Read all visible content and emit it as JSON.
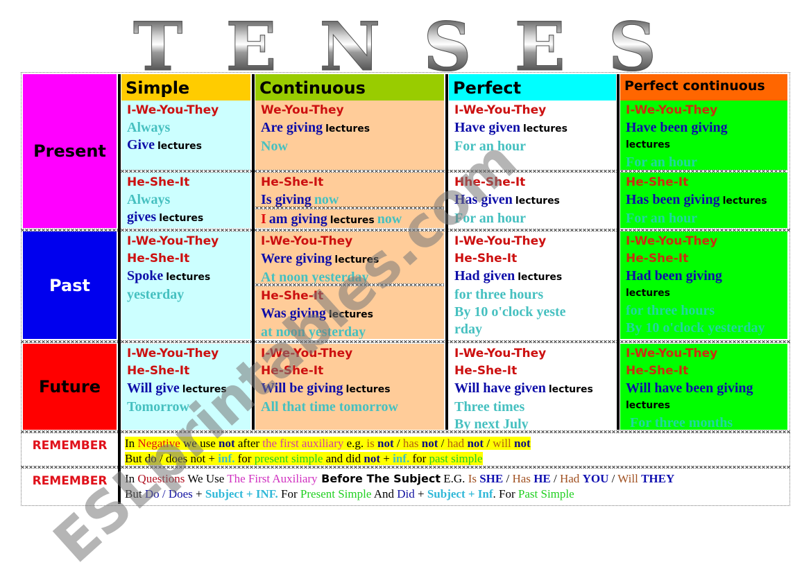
{
  "title": "TENSES",
  "headers": {
    "simple": "Simple",
    "continuous": "Continuous",
    "perfect": "Perfect",
    "perfect_continuous": "Perfect continuous"
  },
  "rows": {
    "present": "Present",
    "past": "Past",
    "future": "Future"
  },
  "colors": {
    "present": "#ff00ff",
    "past": "#0000ee",
    "future": "#ff0000",
    "simple_header": "#ffcc00",
    "continuous_header": "#99cc00",
    "perfect_header": "#00ffff",
    "perfect_continuous_header": "#ff6600",
    "simple_bg": "#ccffff",
    "continuous_bg": "#ffcc99",
    "perfect_bg": "#ffffff",
    "perfect_continuous_bg": "#00ff00"
  },
  "cells": {
    "present_simple_a": {
      "pronoun": "I-We-You-They",
      "time": "Always",
      "verb": "Give",
      "obj": "lectures"
    },
    "present_simple_b": {
      "pronoun": "He-She-It",
      "time": "Always",
      "verb": "gives",
      "obj": "lectures"
    },
    "present_cont_a": {
      "pronoun": "We-You-They",
      "verb": "Are giving",
      "obj": "lectures",
      "time": "Now"
    },
    "present_cont_b": {
      "pronoun": "He-She-It",
      "verb": "Is giving",
      "time": "now"
    },
    "present_cont_c": {
      "subject": "I",
      "verb": "am giving",
      "obj": "lectures",
      "time": "now"
    },
    "present_perf_a": {
      "pronoun": "I-We-You-They",
      "verb": "Have given",
      "obj": "lectures",
      "time": "For an hour"
    },
    "present_perf_b": {
      "pronoun": "Hhe-She-It",
      "verb": "Has given",
      "obj": "lectures",
      "time": "For an hour"
    },
    "present_pc_a": {
      "pronoun": "I-We-You-They",
      "verb": "Have been giving",
      "obj": "lectures",
      "time": "For an hour"
    },
    "present_pc_b": {
      "pronoun": "He-She-It",
      "verb": "Has been giving",
      "obj": "lectures",
      "time": "For an hour"
    },
    "past_simple": {
      "pronoun1": "I-We-You-They",
      "pronoun2": "He-She-It",
      "verb": "Spoke",
      "obj": "lectures",
      "time": "yesterday"
    },
    "past_cont_a": {
      "pronoun": "I-We-You-They",
      "verb": "Were giving",
      "obj": "lectures",
      "time": "At noon yesterday"
    },
    "past_cont_b": {
      "pronoun": "He-She-It",
      "verb": "Was giving",
      "obj": "lectures",
      "time": "at noon yesterday"
    },
    "past_perf": {
      "pronoun1": "I-We-You-They",
      "pronoun2": "He-She-It",
      "verb": "Had given",
      "obj": "lectures",
      "time1": "for three hours",
      "time2a": "By 10 o'clock yeste",
      "time2b": "rday"
    },
    "past_pc": {
      "pronoun1": "I-We-You-They",
      "pronoun2": "He-She-It",
      "verb": "Had been giving",
      "obj": "lectures",
      "time1": "for three hours",
      "time2": "By 10 o'clock yesterday"
    },
    "future_simple": {
      "pronoun1": "I-We-You-They",
      "pronoun2": "He-She-It",
      "verb": "Will give",
      "obj": "lectures",
      "time": "Tomorrow"
    },
    "future_cont": {
      "pronoun1": "I-We-You-They",
      "pronoun2": "He-She-It",
      "verb": "Will be giving",
      "obj": "lectures",
      "time": "All that time tomorrow"
    },
    "future_perf": {
      "pronoun1": "I-We-You-They",
      "pronoun2": "He-She-It",
      "verb": "Will have given",
      "obj": "lectures",
      "time1": "Three times",
      "time2": "By next July"
    },
    "future_pc": {
      "pronoun1": "I-We-You-They",
      "pronoun2": "He-She-It",
      "verb": "Will have been giving",
      "obj": "lectures",
      "time": "For three months"
    }
  },
  "remember": {
    "label": "REMEMBER",
    "negative": {
      "line1": [
        "In ",
        "Negative",
        " we use ",
        "not",
        " after ",
        "the first auxiliary",
        " e.g. ",
        "is",
        " ",
        "not",
        " / ",
        "has",
        " ",
        "not",
        " / ",
        "had",
        " ",
        "not",
        " / ",
        "will",
        " ",
        "not"
      ],
      "line2": [
        "But do / does not + ",
        "inf.",
        " for ",
        "present simple",
        " and did ",
        "not",
        " + ",
        "inf.",
        "  for ",
        "past simple"
      ]
    },
    "questions": {
      "line1": [
        "In ",
        "Questions",
        " We Use ",
        "The First Auxiliary",
        " Before The Subject",
        " E.G. ",
        "Is",
        " ",
        "SHE",
        " / ",
        "Has",
        " ",
        "HE",
        " /  ",
        "Had",
        " ",
        "YOU",
        " / ",
        "Will",
        " ",
        "THEY"
      ],
      "line2": [
        "But ",
        "Do / Does",
        "  + ",
        "Subject + INF.",
        " For ",
        "Present Simple",
        " And ",
        "Did",
        " + ",
        "Subject + Inf",
        ".  For ",
        "Past Simple"
      ]
    }
  },
  "watermark": "ESLprintables.com"
}
